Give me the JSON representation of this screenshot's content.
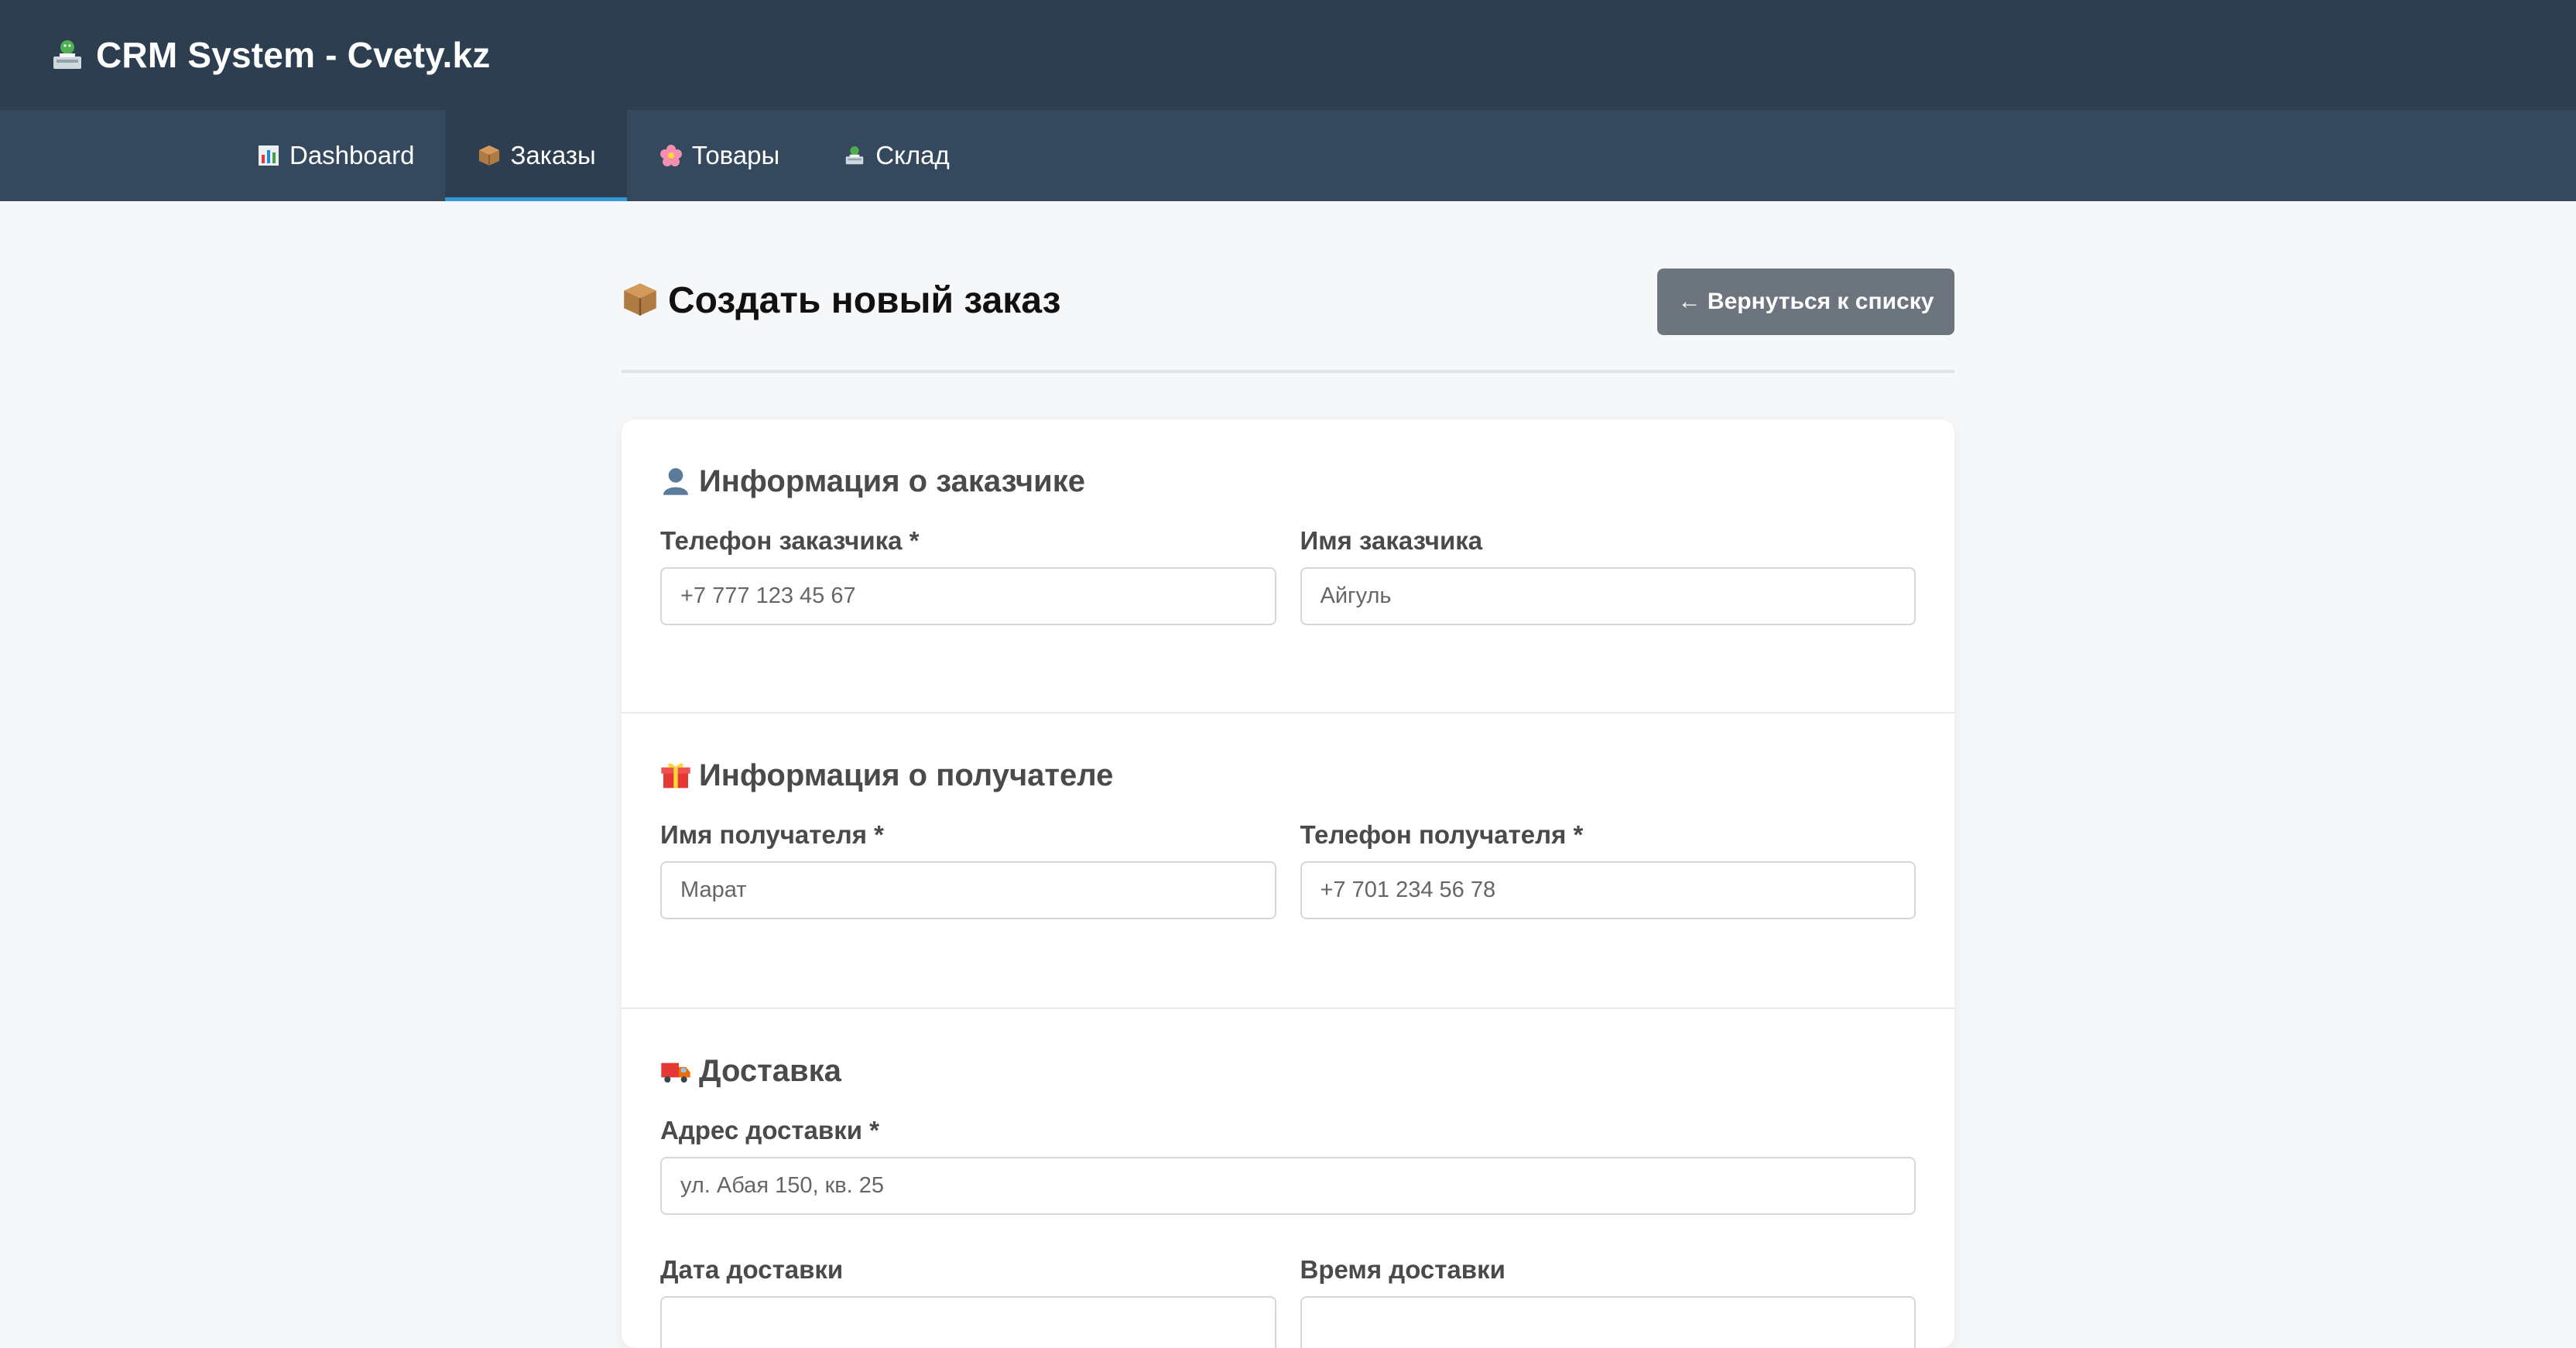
{
  "header": {
    "title": "CRM System - Cvety.kz",
    "logo_icon": "cashier-icon"
  },
  "nav": {
    "items": [
      {
        "label": "Dashboard",
        "icon": "bar-chart-icon",
        "active": false
      },
      {
        "label": "Заказы",
        "icon": "package-icon",
        "active": true
      },
      {
        "label": "Товары",
        "icon": "flower-icon",
        "active": false
      },
      {
        "label": "Склад",
        "icon": "cashier-icon",
        "active": false
      }
    ]
  },
  "page": {
    "title": "Создать новый заказ",
    "back_button": "← Вернуться к списку"
  },
  "customer": {
    "title": "Информация о заказчике",
    "phone_label": "Телефон заказчика *",
    "phone_placeholder": "+7 777 123 45 67",
    "name_label": "Имя заказчика",
    "name_placeholder": "Айгуль"
  },
  "recipient": {
    "title": "Информация о получателе",
    "name_label": "Имя получателя *",
    "name_placeholder": "Марат",
    "phone_label": "Телефон получателя *",
    "phone_placeholder": "+7 701 234 56 78"
  },
  "delivery": {
    "title": "Доставка",
    "address_label": "Адрес доставки *",
    "address_placeholder": "ул. Абая 150, кв. 25",
    "date_label": "Дата доставки",
    "time_label": "Время доставки"
  },
  "colors": {
    "header_bg": "#2c3e50",
    "nav_bg": "#34495e",
    "active_underline": "#3498db",
    "back_button_bg": "#6c757d"
  }
}
